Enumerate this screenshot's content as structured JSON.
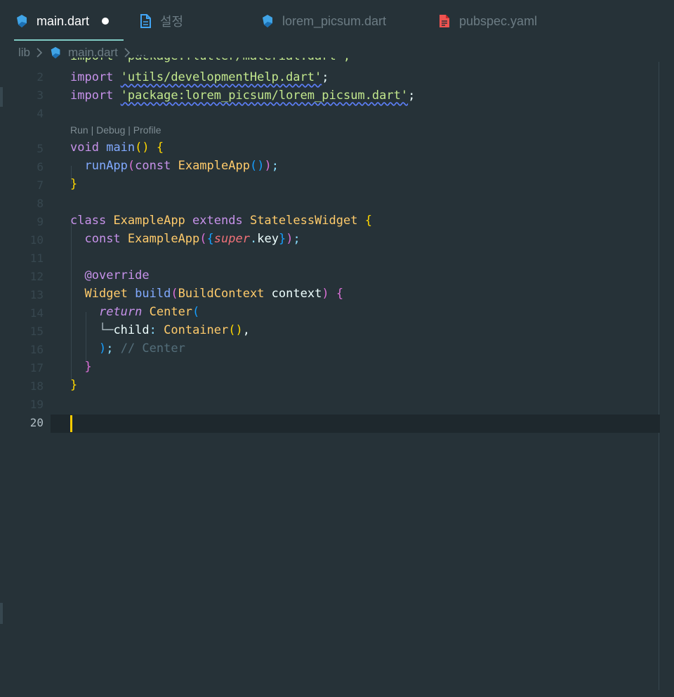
{
  "tabs": [
    {
      "label": "main.dart",
      "icon": "dart-icon",
      "active": true,
      "modified": true
    },
    {
      "label": "설정",
      "icon": "file-icon"
    },
    {
      "label": "lorem_picsum.dart",
      "icon": "dart-icon"
    },
    {
      "label": "pubspec.yaml",
      "icon": "yaml-file-icon"
    }
  ],
  "breadcrumb": {
    "folder": "lib",
    "file": "main.dart",
    "more": "..."
  },
  "codelens": {
    "run": "Run",
    "debug": "Debug",
    "profile": "Profile",
    "separator": " | "
  },
  "gutter": [
    "2",
    "3",
    "4",
    "5",
    "6",
    "7",
    "8",
    "9",
    "10",
    "11",
    "12",
    "13",
    "14",
    "15",
    "16",
    "17",
    "18",
    "19",
    "20"
  ],
  "code": {
    "l1": "import 'package:flutter/material.dart';",
    "l2_kw": "import",
    "l2_str": "'utils/developmentHelp.dart'",
    "l2_end": ";",
    "l3_kw": "import",
    "l3_str": "'package:lorem_picsum/lorem_picsum.dart'",
    "l3_end": ";",
    "l5_type": "void",
    "l5_fn": "main",
    "l6_fn": "runApp",
    "l6_kw": "const",
    "l6_cls": "ExampleApp",
    "l9_kw": "class",
    "l9_cls": "ExampleApp",
    "l9_ext": "extends",
    "l9_parent": "StatelessWidget",
    "l10_kw": "const",
    "l10_cls": "ExampleApp",
    "l10_super": "super",
    "l10_key": "key",
    "l12_anno": "@override",
    "l13_type": "Widget",
    "l13_fn": "build",
    "l13_param_type": "BuildContext",
    "l13_param": "context",
    "l14_ret": "return",
    "l14_cls": "Center",
    "l15_tree": "└─",
    "l15_prop": "child",
    "l15_cls": "Container",
    "l16_comment": "// Center"
  }
}
